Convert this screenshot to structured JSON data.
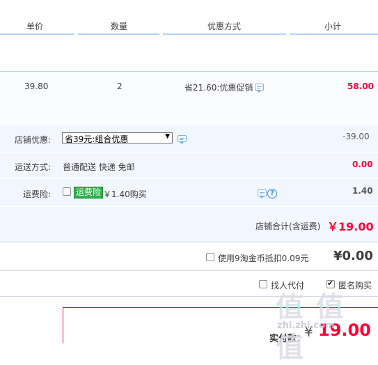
{
  "header": {
    "col_price": "单价",
    "col_qty": "数量",
    "col_discount": "优惠方式",
    "col_subtotal": "小计"
  },
  "item": {
    "price": "39.80",
    "qty": "2",
    "discount": "省21.60:优惠促销",
    "subtotal": "58.00"
  },
  "shop_discount": {
    "label": "店铺优惠:",
    "selected": "省39元:组合优惠",
    "amount": "-39.00"
  },
  "shipping": {
    "label": "运送方式:",
    "value": "普通配送 快递 免邮",
    "amount": "0.00"
  },
  "insurance": {
    "label": "运费险:",
    "badge": "运费险",
    "price": "￥1.40购买",
    "amount": "1.40",
    "checked": false
  },
  "shop_total": {
    "label": "店铺合计(含运费)",
    "value": "￥19.00"
  },
  "coins": {
    "label": "使用9淘金币抵扣0.09元",
    "value": "¥0.00",
    "checked": false
  },
  "options": {
    "proxy_pay": "找人代付",
    "proxy_checked": false,
    "anonymous": "匿名购买",
    "anonymous_checked": true
  },
  "final": {
    "label": "实付款：",
    "currency": "¥",
    "value": "19.00"
  },
  "watermark": {
    "text": "值 值 值",
    "sub": "zhi.zhi.com"
  },
  "colors": {
    "accent_red": "#ff0036",
    "header_line": "#b2d1ff",
    "row_bg": "#f2f7ff",
    "badge_green": "#2cb04a"
  }
}
